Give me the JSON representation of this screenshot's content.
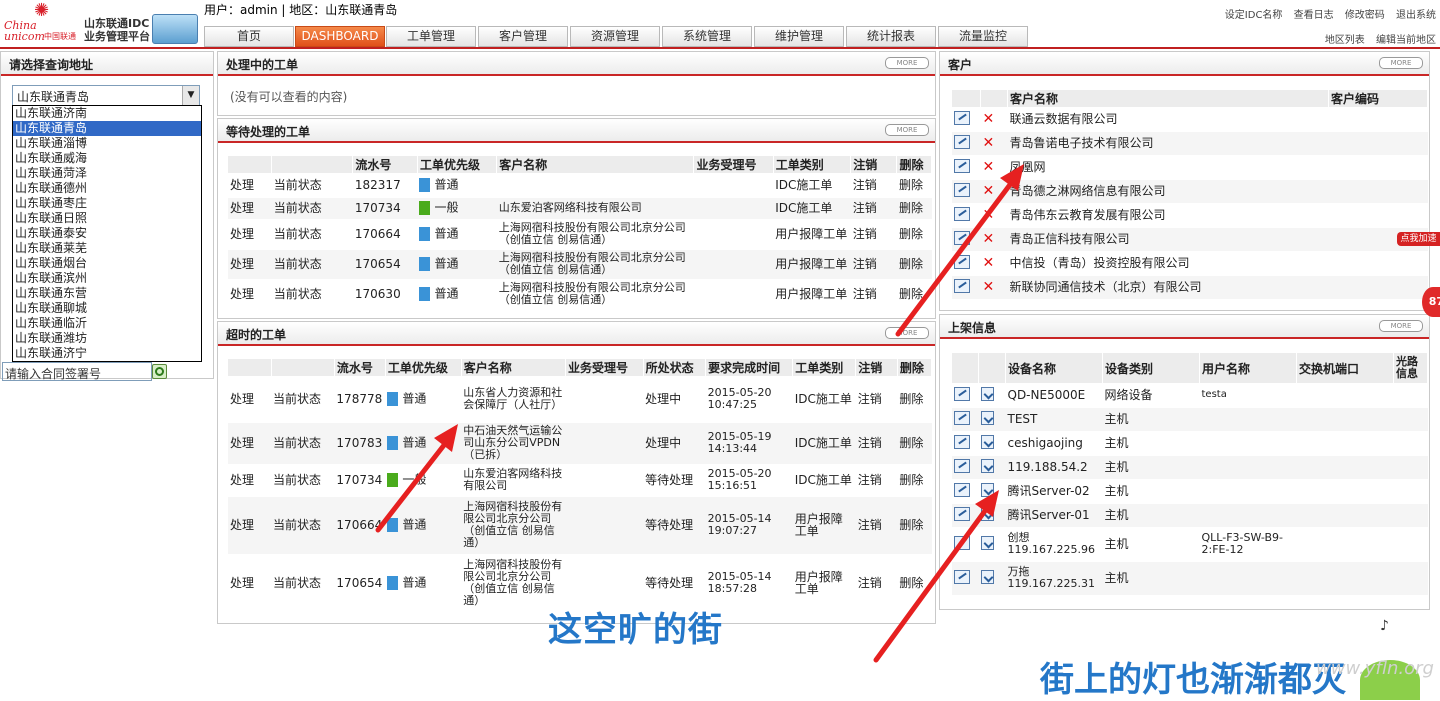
{
  "header": {
    "logo": {
      "china": "China",
      "unicom": "unicom",
      "cn_name": "中国联通",
      "line1": "山东联通IDC",
      "line2": "业务管理平台"
    },
    "user_line": "用户：admin  |  地区：山东联通青岛",
    "top_links": [
      "设定IDC名称",
      "查看日志",
      "修改密码",
      "退出系统"
    ],
    "sub_links": [
      "地区列表",
      "编辑当前地区"
    ],
    "nav": [
      "首页",
      "DASHBOARD",
      "工单管理",
      "客户管理",
      "资源管理",
      "系统管理",
      "维护管理",
      "统计报表",
      "流量监控"
    ]
  },
  "left": {
    "title": "请选择查询地址",
    "selected": "山东联通青岛",
    "options": [
      "山东联通济南",
      "山东联通青岛",
      "山东联通淄博",
      "山东联通威海",
      "山东联通菏泽",
      "山东联通德州",
      "山东联通枣庄",
      "山东联通日照",
      "山东联通泰安",
      "山东联通莱芜",
      "山东联通烟台",
      "山东联通滨州",
      "山东联通东营",
      "山东联通聊城",
      "山东联通临沂",
      "山东联通潍坊",
      "山东联通济宁"
    ],
    "contract_placeholder": "请输入合同签署号"
  },
  "processing": {
    "title": "处理中的工单",
    "more": "MORE",
    "empty": "(没有可以查看的内容)"
  },
  "waiting": {
    "title": "等待处理的工单",
    "more": "MORE",
    "headers": [
      "",
      "",
      "流水号",
      "工单优先级",
      "客户名称",
      "业务受理号",
      "工单类别",
      "注销",
      "删除"
    ],
    "rows": [
      {
        "a": "处理",
        "b": "当前状态",
        "no": "182317",
        "pri": "普通",
        "color": "blue",
        "cust": "",
        "biz": "",
        "type": "IDC施工单",
        "c": "注销",
        "d": "删除"
      },
      {
        "a": "处理",
        "b": "当前状态",
        "no": "170734",
        "pri": "一般",
        "color": "green",
        "cust": "山东爱泊客网络科技有限公司",
        "biz": "",
        "type": "IDC施工单",
        "c": "注销",
        "d": "删除"
      },
      {
        "a": "处理",
        "b": "当前状态",
        "no": "170664",
        "pri": "普通",
        "color": "blue",
        "cust": "上海网宿科技股份有限公司北京分公司（创值立信 创易信通）",
        "biz": "",
        "type": "用户报障工单",
        "c": "注销",
        "d": "删除"
      },
      {
        "a": "处理",
        "b": "当前状态",
        "no": "170654",
        "pri": "普通",
        "color": "blue",
        "cust": "上海网宿科技股份有限公司北京分公司（创值立信 创易信通）",
        "biz": "",
        "type": "用户报障工单",
        "c": "注销",
        "d": "删除"
      },
      {
        "a": "处理",
        "b": "当前状态",
        "no": "170630",
        "pri": "普通",
        "color": "blue",
        "cust": "上海网宿科技股份有限公司北京分公司（创值立信 创易信通）",
        "biz": "",
        "type": "用户报障工单",
        "c": "注销",
        "d": "删除"
      }
    ]
  },
  "overdue": {
    "title": "超时的工单",
    "more": "MORE",
    "headers": [
      "",
      "",
      "流水号",
      "工单优先级",
      "客户名称",
      "业务受理号",
      "所处状态",
      "要求完成时间",
      "工单类别",
      "注销",
      "删除"
    ],
    "rows": [
      {
        "a": "处理",
        "b": "当前状态",
        "no": "178778",
        "pri": "普通",
        "color": "blue",
        "cust": "山东省人力资源和社会保障厅（人社厅）",
        "biz": "",
        "state": "处理中",
        "time": "2015-05-20 10:47:25",
        "type": "IDC施工单",
        "c": "注销",
        "d": "删除"
      },
      {
        "a": "处理",
        "b": "当前状态",
        "no": "170783",
        "pri": "普通",
        "color": "blue",
        "cust": "中石油天然气运输公司山东分公司VPDN（已拆）",
        "biz": "",
        "state": "处理中",
        "time": "2015-05-19 14:13:44",
        "type": "IDC施工单",
        "c": "注销",
        "d": "删除"
      },
      {
        "a": "处理",
        "b": "当前状态",
        "no": "170734",
        "pri": "一般",
        "color": "green",
        "cust": "山东爱泊客网络科技有限公司",
        "biz": "",
        "state": "等待处理",
        "time": "2015-05-20 15:16:51",
        "type": "IDC施工单",
        "c": "注销",
        "d": "删除"
      },
      {
        "a": "处理",
        "b": "当前状态",
        "no": "170664",
        "pri": "普通",
        "color": "blue",
        "cust": "上海网宿科技股份有限公司北京分公司（创值立信 创易信通）",
        "biz": "",
        "state": "等待处理",
        "time": "2015-05-14 19:07:27",
        "type": "用户报障工单",
        "c": "注销",
        "d": "删除"
      },
      {
        "a": "处理",
        "b": "当前状态",
        "no": "170654",
        "pri": "普通",
        "color": "blue",
        "cust": "上海网宿科技股份有限公司北京分公司（创值立信 创易信通）",
        "biz": "",
        "state": "等待处理",
        "time": "2015-05-14 18:57:28",
        "type": "用户报障工单",
        "c": "注销",
        "d": "删除"
      }
    ]
  },
  "customers": {
    "title": "客户",
    "more": "MORE",
    "headers": [
      "",
      "",
      "客户名称",
      "客户编码"
    ],
    "rows": [
      "联通云数据有限公司",
      "青岛鲁诺电子技术有限公司",
      "凤凰网",
      "青岛德之淋网络信息有限公司",
      "青岛伟东云教育发展有限公司",
      "青岛正信科技有限公司",
      "中信投（青岛）投资控股有限公司",
      "新联协同通信技术（北京）有限公司"
    ]
  },
  "devices": {
    "title": "上架信息",
    "more": "MORE",
    "headers": [
      "",
      "",
      "设备名称",
      "设备类别",
      "用户名称",
      "交换机端口",
      "光路信息"
    ],
    "rows": [
      {
        "name": "QD-NE5000E",
        "cat": "网络设备",
        "user": "testa",
        "port": ""
      },
      {
        "name": "TEST",
        "cat": "主机",
        "user": "",
        "port": ""
      },
      {
        "name": "ceshigaojing",
        "cat": "主机",
        "user": "",
        "port": ""
      },
      {
        "name": "119.188.54.2",
        "cat": "主机",
        "user": "",
        "port": ""
      },
      {
        "name": "腾讯Server-02",
        "cat": "主机",
        "user": "",
        "port": ""
      },
      {
        "name": "腾讯Server-01",
        "cat": "主机",
        "user": "",
        "port": ""
      },
      {
        "name": "创想119.167.225.96",
        "cat": "主机",
        "user": "QLL-F3-SW-B9-2:FE-12",
        "port": ""
      },
      {
        "name": "万拖119.167.225.31",
        "cat": "主机",
        "user": "",
        "port": ""
      }
    ]
  },
  "overlay": {
    "lyric1": "这空旷的街",
    "lyric2": "街上的灯也渐渐都灭",
    "watermark": "www.yfln.org",
    "speed_badge": "点我加速",
    "speed_value": "87",
    "music_note": "♪",
    "arrow_color": "#e62020"
  }
}
